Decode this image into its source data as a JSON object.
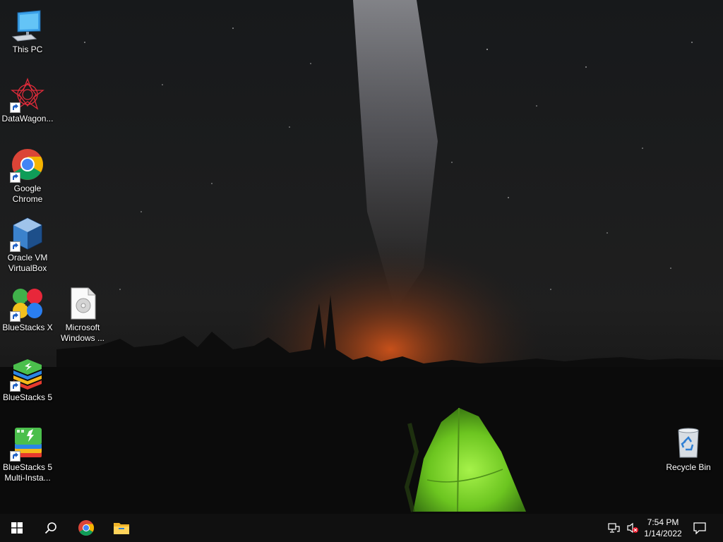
{
  "desktop": {
    "icons": [
      {
        "label": "This PC",
        "icon": "computer-icon",
        "shortcut": false
      },
      {
        "label": "DataWagon...",
        "icon": "datawagon-icon",
        "shortcut": true
      },
      {
        "label": "Google Chrome",
        "icon": "chrome-icon",
        "shortcut": true
      },
      {
        "label": "Oracle VM VirtualBox",
        "icon": "virtualbox-icon",
        "shortcut": true
      },
      {
        "label": "BlueStacks X",
        "icon": "bluestacks-x-icon",
        "shortcut": true
      },
      {
        "label": "Microsoft Windows ...",
        "icon": "document-file-icon",
        "shortcut": false
      },
      {
        "label": "BlueStacks 5",
        "icon": "bluestacks-5-icon",
        "shortcut": true
      },
      {
        "label": "BlueStacks 5 Multi-Insta...",
        "icon": "bluestacks-multi-instance-icon",
        "shortcut": true
      },
      {
        "label": "Recycle Bin",
        "icon": "recycle-bin-icon",
        "shortcut": false
      }
    ]
  },
  "taskbar": {
    "start_icon": "windows-start-icon",
    "search_icon": "search-icon",
    "pinned": [
      "chrome-icon",
      "file-explorer-icon"
    ],
    "tray": {
      "network_icon": "network-icon",
      "volume_icon": "volume-muted-icon",
      "time": "7:54 PM",
      "date": "1/14/2022",
      "notification_icon": "action-center-icon"
    }
  },
  "colors": {
    "taskbar": "#101010",
    "tent": "#7bd62b",
    "horizon_glow": "#c8561e",
    "sky": "#1a1c1e"
  }
}
